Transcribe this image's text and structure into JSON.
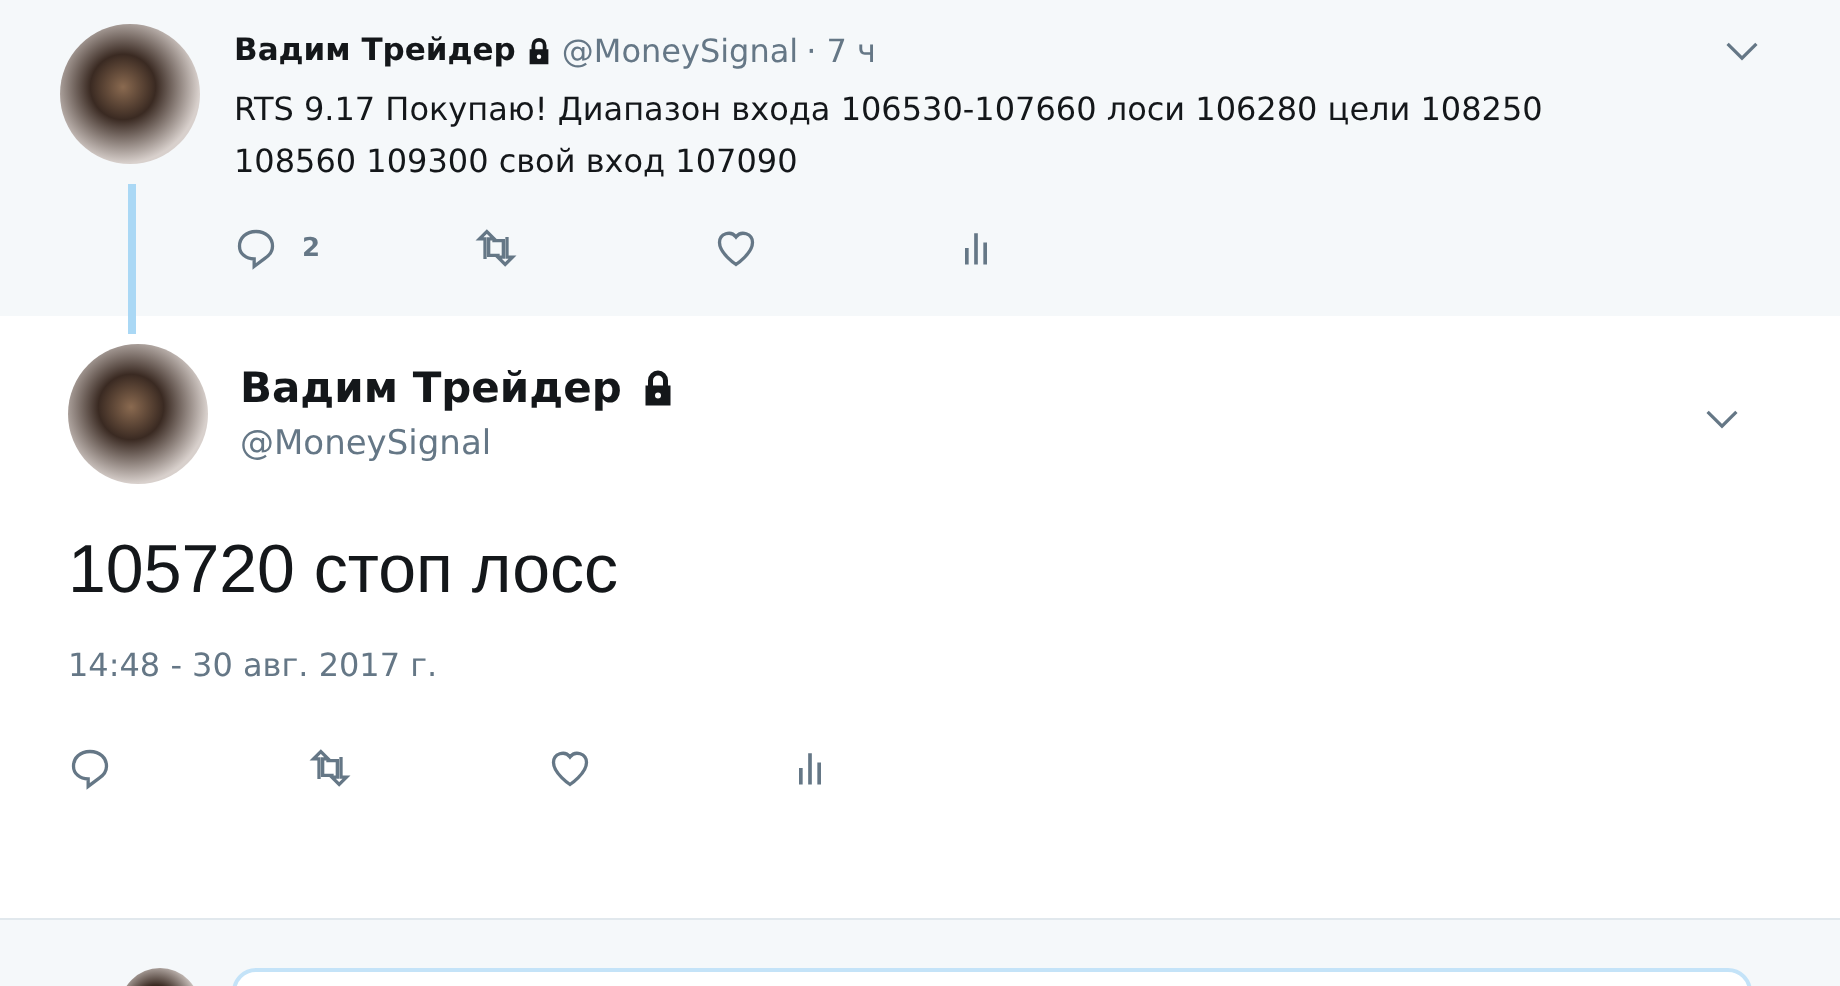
{
  "parent_tweet": {
    "name": "Вадим Трейдер",
    "handle": "@MoneySignal",
    "time": "· 7 ч",
    "text": "RTS 9.17 Покупаю! Диапазон входа 106530-107660 лоси 106280 цели 108250 108560 109300 свой вход 107090",
    "reply_count": "2"
  },
  "main_tweet": {
    "name": "Вадим Трейдер",
    "handle": "@MoneySignal",
    "text": "105720 стоп лосс",
    "timestamp": "14:48 - 30 авг. 2017 г."
  }
}
